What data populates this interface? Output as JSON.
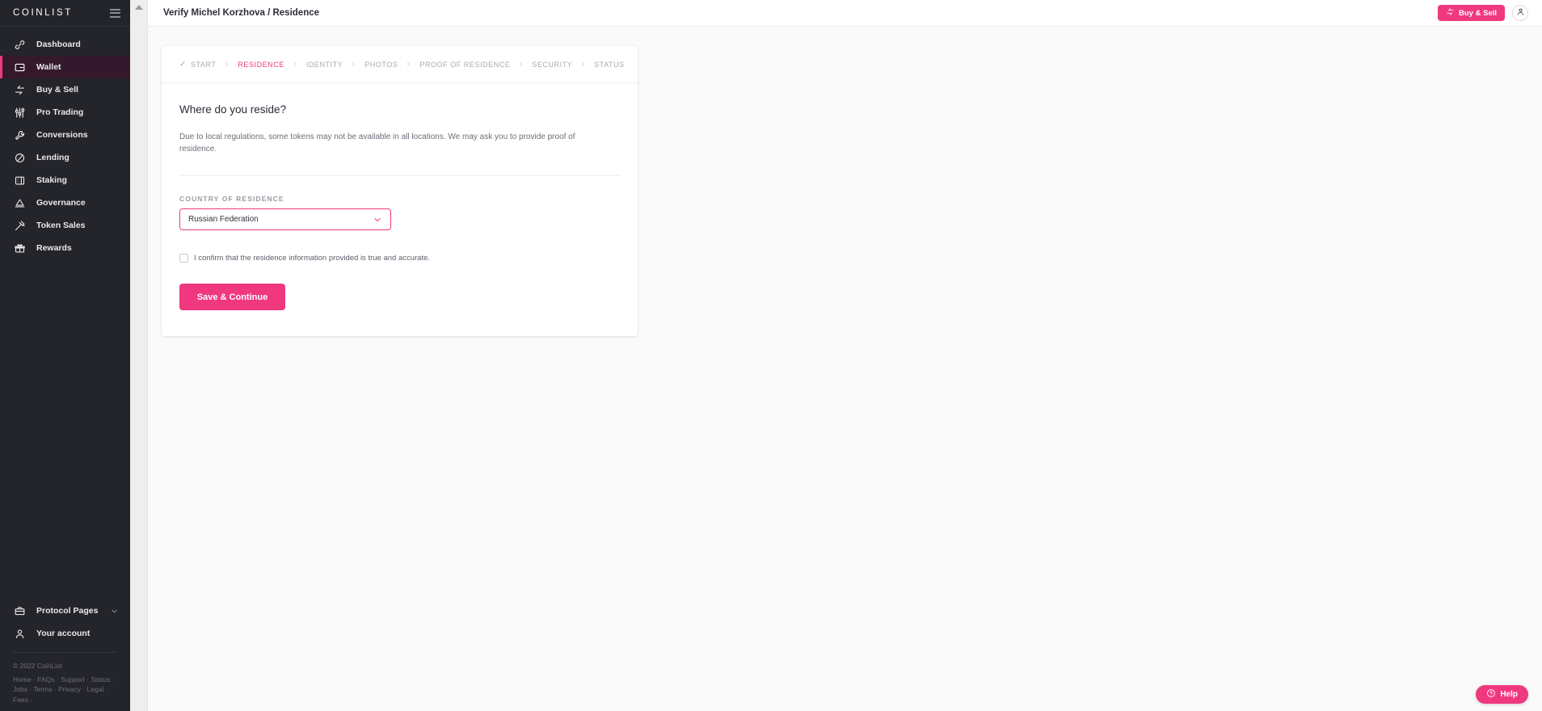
{
  "brand": {
    "logo": "COINLIST",
    "accent": "#f0387f",
    "sidebar_bg": "#24242b",
    "active_bg": "#34192c"
  },
  "sidebar": {
    "menu_icon": "hamburger-icon",
    "items": [
      {
        "label": "Dashboard",
        "icon": "link-icon",
        "active": false
      },
      {
        "label": "Wallet",
        "icon": "wallet-icon",
        "active": true
      },
      {
        "label": "Buy & Sell",
        "icon": "swap-arrows-icon",
        "active": false
      },
      {
        "label": "Pro Trading",
        "icon": "sliders-icon",
        "active": false
      },
      {
        "label": "Conversions",
        "icon": "wrench-icon",
        "active": false
      },
      {
        "label": "Lending",
        "icon": "circle-slash-icon",
        "active": false
      },
      {
        "label": "Staking",
        "icon": "stack-box-icon",
        "active": false
      },
      {
        "label": "Governance",
        "icon": "gavel-block-icon",
        "active": false
      },
      {
        "label": "Token Sales",
        "icon": "gavel-icon",
        "active": false
      },
      {
        "label": "Rewards",
        "icon": "gift-icon",
        "active": false
      }
    ],
    "bottom_items": [
      {
        "label": "Protocol Pages",
        "icon": "briefcase-icon",
        "chevron": "chevron-down-icon"
      },
      {
        "label": "Your account",
        "icon": "person-icon",
        "chevron": null
      }
    ],
    "footer": {
      "copyright": "© 2022 CoinList",
      "links_row1": "Home · FAQs · Support · Status ·",
      "links_row2": "Jobs · Terms · Privacy · Legal · Fees ·"
    }
  },
  "header": {
    "title": "Verify Michel Korzhova / Residence",
    "buy_sell_label": "Buy & Sell",
    "buy_sell_icon": "swap-arrows-icon",
    "account_icon": "person-icon"
  },
  "stepper": {
    "steps": [
      {
        "label": "START",
        "state": "done"
      },
      {
        "label": "RESIDENCE",
        "state": "current"
      },
      {
        "label": "IDENTITY",
        "state": "todo"
      },
      {
        "label": "PHOTOS",
        "state": "todo"
      },
      {
        "label": "PROOF OF RESIDENCE",
        "state": "todo"
      },
      {
        "label": "SECURITY",
        "state": "todo"
      },
      {
        "label": "STATUS",
        "state": "todo"
      }
    ],
    "check_glyph": "✓",
    "separator_icon": "chevron-right-icon"
  },
  "form": {
    "heading": "Where do you reside?",
    "description": "Due to local regulations, some tokens may not be available in all locations. We may ask you to provide proof of residence.",
    "country_label": "COUNTRY OF RESIDENCE",
    "country_value": "Russian Federation",
    "country_chevron_icon": "chevron-down-icon",
    "confirm_text": "I confirm that the residence information provided is true and accurate.",
    "confirm_checked": false,
    "submit_label": "Save & Continue"
  },
  "help": {
    "label": "Help",
    "icon": "question-circle-icon"
  }
}
